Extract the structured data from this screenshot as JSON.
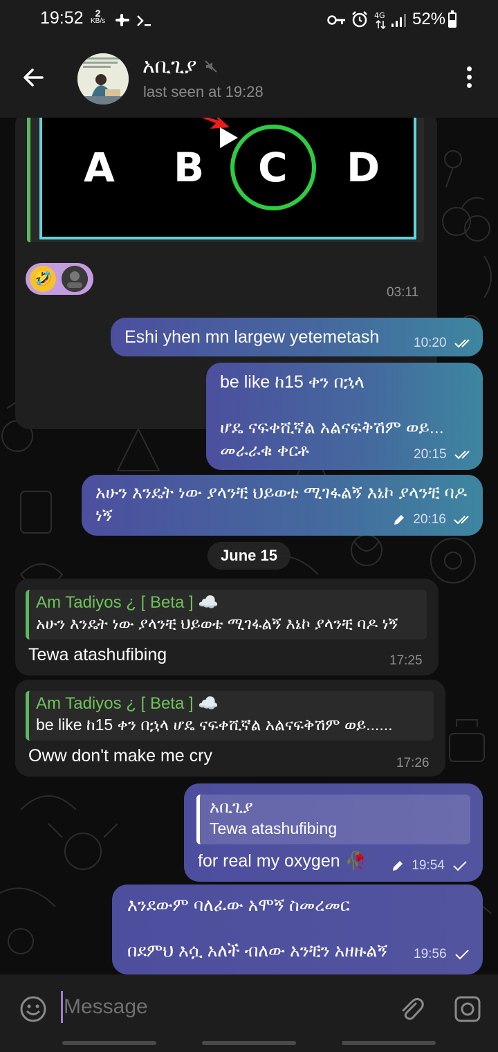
{
  "status_bar": {
    "time": "19:52",
    "net_speed_value": "2",
    "net_speed_unit": "KB/s",
    "battery": "52%",
    "battery_level": 0.52,
    "icons": [
      "fan-icon",
      "terminal-icon",
      "key-icon",
      "alarm-icon",
      "4g-icon",
      "signal-icon",
      "battery-icon"
    ]
  },
  "header": {
    "contact_name": "አቢጊያ",
    "last_seen": "last seen at 19:28",
    "muted": true
  },
  "video_message": {
    "options": [
      "A",
      "B",
      "C",
      "D"
    ],
    "time": "03:11",
    "reaction_emoji": "🤣"
  },
  "messages": [
    {
      "text": "Eshi yhen mn largew yetemetash",
      "time": "10:20",
      "status": "read"
    },
    {
      "text": "be like ከ15 ቀን በኋላ\n\nሆዴ ናፍቀሺኛል አልናፍቅሽም ወይ...\nመራራቁ ቀርቶ",
      "time": "20:15",
      "status": "read"
    },
    {
      "text": "አሁን እንዴት ነው ያላንቺ ህይወቴ ሚገፋልኝ እኔኮ ያላንቺ ባዶ ነኝ",
      "time": "20:16",
      "status": "read",
      "edited": true
    },
    {
      "text": "Tewa atashufibing",
      "time": "17:25",
      "reply_name": "Am Tadiyos ¿ [ Beta ] ☁️",
      "reply_text": "አሁን እንዴት ነው ያላንቺ ህይወቴ ሚገፋልኝ እኔኮ ያላንቺ ባዶ ነኝ"
    },
    {
      "text": "Oww don't make me cry",
      "time": "17:26",
      "reply_name": "Am Tadiyos ¿ [ Beta ] ☁️",
      "reply_text": "be like ከ15 ቀን በኋላ  ሆዴ ናፍቀሺኛል አልናፍቅሽም ወይ......"
    },
    {
      "text": "for real my oxygen 🥀",
      "time": "19:54",
      "status": "sent",
      "edited": true,
      "reply_name": "አቢጊያ",
      "reply_text": "Tewa atashufibing"
    },
    {
      "text": "እንደውም ባለፈው አሞኝ ስመረመር\n\nበደምህ እሷ አለች ብለው አንቺን አዘዙልኝ",
      "time": "19:56",
      "status": "sent"
    }
  ],
  "date_separator": "June 15",
  "input": {
    "placeholder": "Message"
  },
  "colors": {
    "outgoing_bubble": "#4c4f9e",
    "incoming_bubble": "#1f1f1f",
    "reply_accent": "#5cb85c",
    "background": "#0d0d0d"
  }
}
